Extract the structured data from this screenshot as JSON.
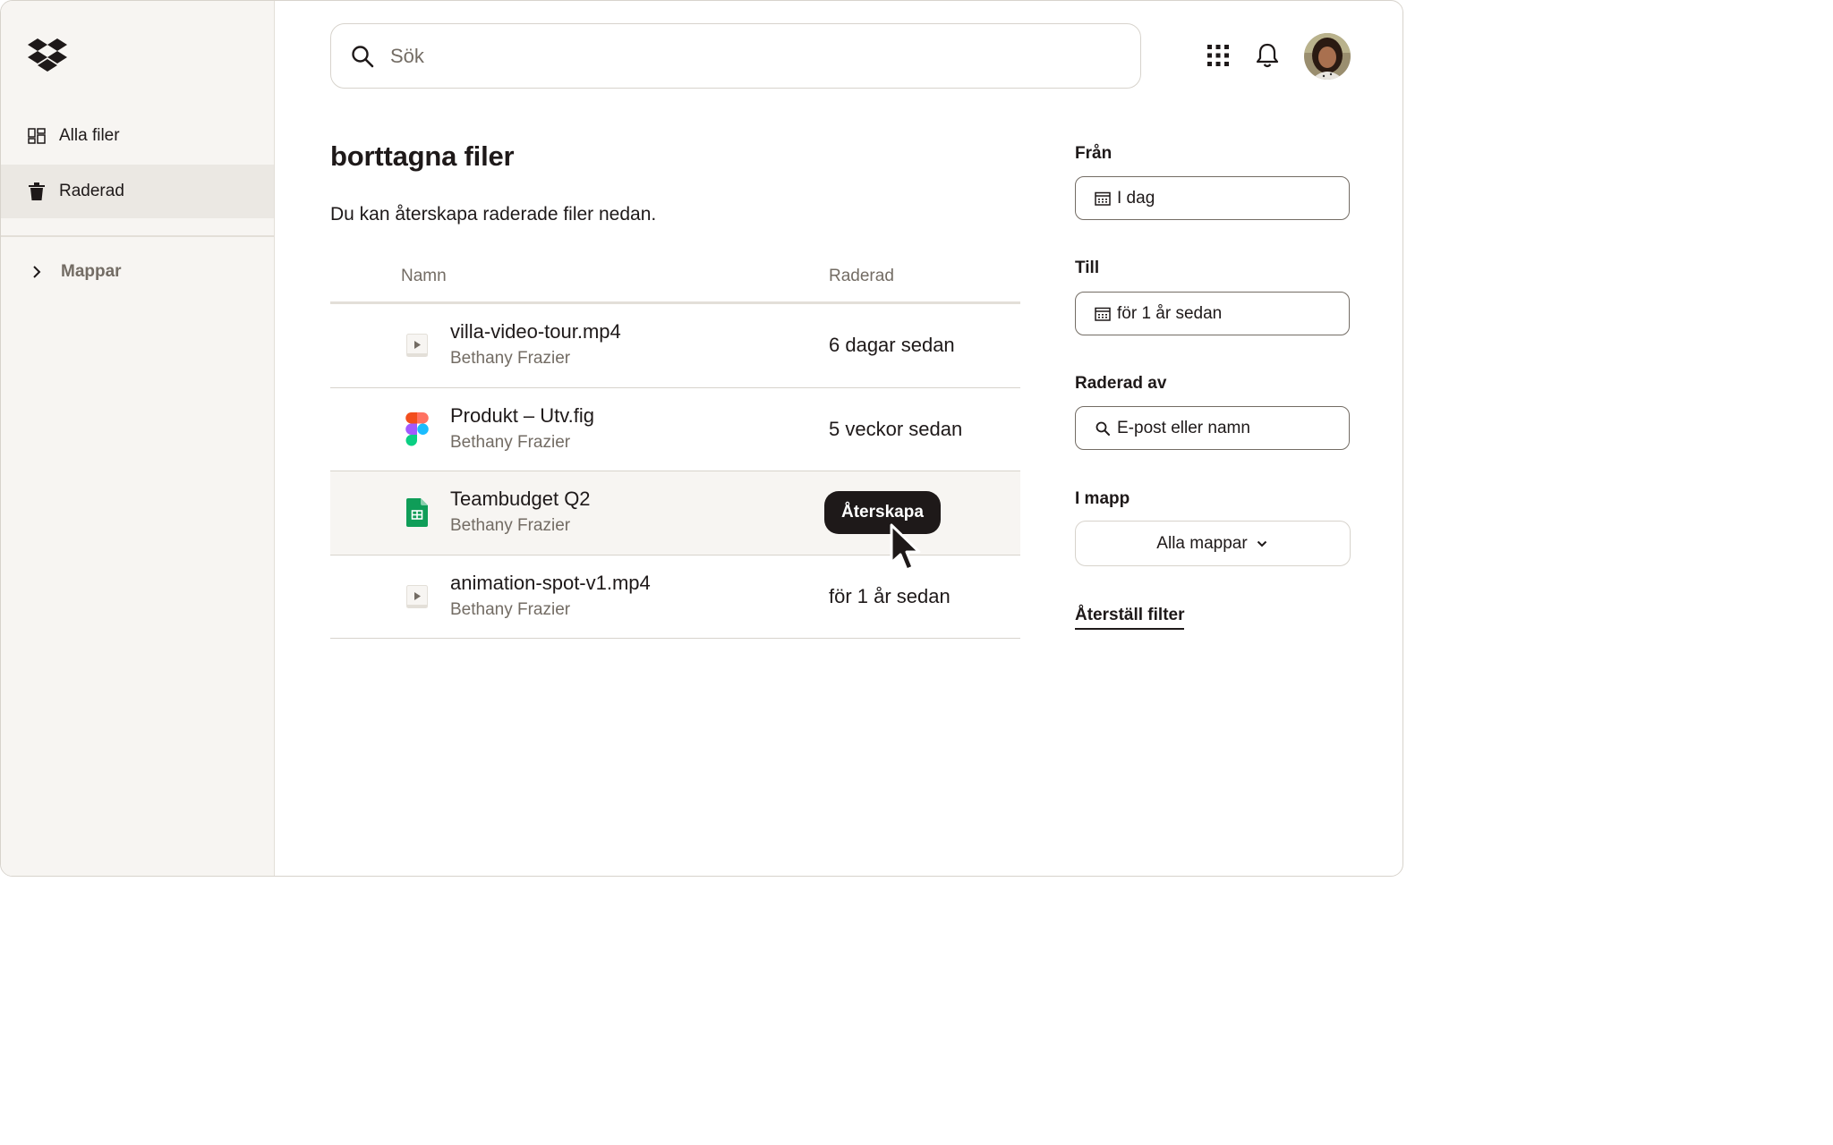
{
  "sidebar": {
    "logo_icon": "dropbox-logo-icon",
    "items": [
      {
        "label": "Alla filer",
        "icon": "all-files-icon",
        "active": false
      },
      {
        "label": "Raderad",
        "icon": "trash-icon",
        "active": true
      }
    ],
    "folders_label": "Mappar"
  },
  "header": {
    "search_placeholder": "Sök",
    "apps_icon": "app-grid-icon",
    "notifications_icon": "bell-icon",
    "avatar_icon": "user-avatar"
  },
  "main": {
    "title": "borttagna filer",
    "subtitle": "Du kan återskapa raderade filer nedan.",
    "columns": {
      "name": "Namn",
      "deleted": "Raderad"
    },
    "files": [
      {
        "name": "villa-video-tour.mp4",
        "owner": "Bethany Frazier",
        "deleted": "6 dagar sedan",
        "type": "video"
      },
      {
        "name": "Produkt – Utv.fig",
        "owner": "Bethany Frazier",
        "deleted": "5 veckor sedan",
        "type": "figma"
      },
      {
        "name": "Teambudget Q2",
        "owner": "Bethany Frazier",
        "deleted": "",
        "type": "sheets",
        "hovered": true,
        "action_label": "Återskapa"
      },
      {
        "name": "animation-spot-v1.mp4",
        "owner": "Bethany Frazier",
        "deleted": "för 1 år sedan",
        "type": "video"
      }
    ]
  },
  "filters": {
    "from_label": "Från",
    "from_value": "I dag",
    "to_label": "Till",
    "to_value": "för 1 år sedan",
    "deleted_by_label": "Raderad av",
    "deleted_by_placeholder": "E-post eller namn",
    "folder_label": "I mapp",
    "folder_value": "Alla mappar",
    "reset_label": "Återställ filter"
  },
  "colors": {
    "sidebar_bg": "#f7f5f2",
    "active_item_bg": "#ebe8e3",
    "text_primary": "#1e1919",
    "text_secondary": "#736c64",
    "button_bg": "#1e1919",
    "sheets_green": "#0f9d58"
  }
}
